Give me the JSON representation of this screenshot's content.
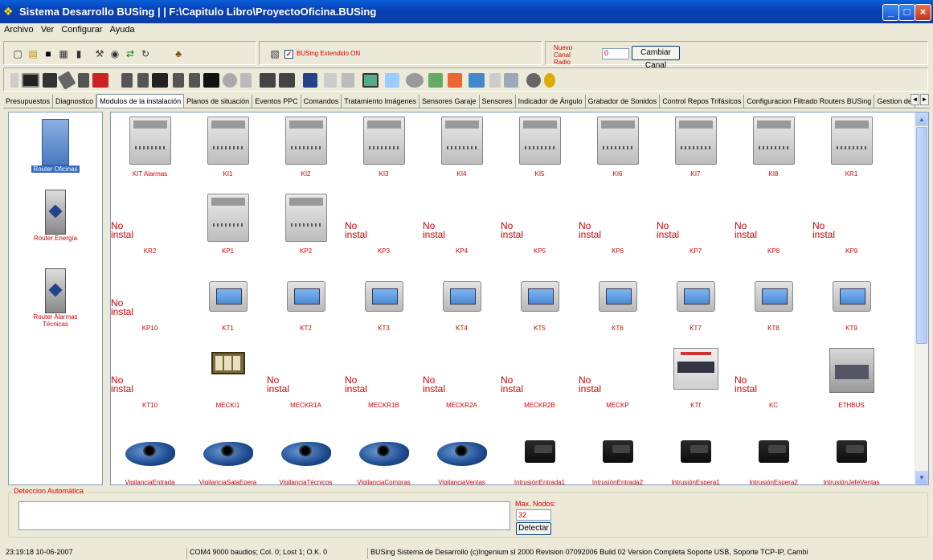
{
  "window": {
    "title": "Sistema Desarrollo BUSing | | F:\\Capitulo Libro\\ProyectoOficina.BUSing",
    "minimize": "_",
    "maximize": "□",
    "close": "×"
  },
  "menu": [
    "Archivo",
    "Ver",
    "Configurar",
    "Ayuda"
  ],
  "toolbar": {
    "extended_label": "BUSing Extendido ON",
    "extended_checked": "✓",
    "nuevo_canal_label": "Nuevo Canal Radio",
    "canal_value": "0",
    "cambiar_canal": "Cambiar Canal",
    "icons": [
      "new-icon",
      "open-icon",
      "save-icon",
      "edit-icon",
      "delete-icon",
      "tools-icon",
      "eye-icon",
      "transfer-icon",
      "refresh-icon",
      "network-icon",
      "scan-icon"
    ]
  },
  "device_toolbar_icons": [
    "module-icon",
    "panel-icon",
    "sensor-icon",
    "pen-icon",
    "din-icon",
    "red-device-icon",
    "din-icon",
    "din-icon",
    "keypad-icon",
    "din-icon",
    "din-icon",
    "black-module-icon",
    "speaker-icon",
    "meter-icon",
    "din-icon",
    "din-icon",
    "screen-icon",
    "switch-icon",
    "box-icon",
    "monitor-icon",
    "tag-icon",
    "camera-icon",
    "window-icon",
    "plant-icon",
    "strip-icon",
    "pipe-icon",
    "sprinkler-icon",
    "gear-icon",
    "key-icon"
  ],
  "tabs": [
    "Presupuestos",
    "Diagnostico",
    "Modulos de la instalación",
    "Planos de situación",
    "Eventos PPC",
    "Comandos",
    "Tratamiento Imágenes",
    "Sensores Garaje",
    "Sensores",
    "Indicador de Ángulo",
    "Grabador de Sonidos",
    "Control Repos Trifásicos",
    "Configuracion Filtrado Routers BUSing",
    "Gestion de"
  ],
  "active_tab": "Modulos de la instalación",
  "tab_scroll_left": "◄",
  "tab_scroll_right": "►",
  "routers": [
    {
      "label": "Router Oficinas",
      "selected": true
    },
    {
      "label": "Router Energía",
      "selected": false
    },
    {
      "label": "Router Alarmas Técnicas",
      "selected": false
    }
  ],
  "no_instalado": "No instal",
  "modules": [
    [
      {
        "label": "KIT Alarmas",
        "type": "din",
        "installed": true
      },
      {
        "label": "KI1",
        "type": "din",
        "installed": true
      },
      {
        "label": "KI2",
        "type": "din",
        "installed": true
      },
      {
        "label": "KI3",
        "type": "din",
        "installed": true
      },
      {
        "label": "KI4",
        "type": "din",
        "installed": true
      },
      {
        "label": "KI5",
        "type": "din",
        "installed": true
      },
      {
        "label": "KI6",
        "type": "din",
        "installed": true
      },
      {
        "label": "KI7",
        "type": "din",
        "installed": true
      },
      {
        "label": "KI8",
        "type": "din",
        "installed": true
      },
      {
        "label": "KR1",
        "type": "din",
        "installed": true
      }
    ],
    [
      {
        "label": "KR2",
        "type": "din",
        "installed": false
      },
      {
        "label": "KP1",
        "type": "din",
        "installed": true
      },
      {
        "label": "KP2",
        "type": "din",
        "installed": true
      },
      {
        "label": "KP3",
        "type": "din",
        "installed": false
      },
      {
        "label": "KP4",
        "type": "din",
        "installed": false
      },
      {
        "label": "KP5",
        "type": "din",
        "installed": false
      },
      {
        "label": "KP6",
        "type": "din",
        "installed": false
      },
      {
        "label": "KP7",
        "type": "din",
        "installed": false
      },
      {
        "label": "KP8",
        "type": "din",
        "installed": false
      },
      {
        "label": "KP9",
        "type": "din",
        "installed": false
      }
    ],
    [
      {
        "label": "KP10",
        "type": "panel",
        "installed": false
      },
      {
        "label": "KT1",
        "type": "panel",
        "installed": true
      },
      {
        "label": "KT2",
        "type": "panel",
        "installed": true
      },
      {
        "label": "KT3",
        "type": "panel",
        "installed": true
      },
      {
        "label": "KT4",
        "type": "panel",
        "installed": true
      },
      {
        "label": "KT5",
        "type": "panel",
        "installed": true
      },
      {
        "label": "KT6",
        "type": "panel",
        "installed": true
      },
      {
        "label": "KT7",
        "type": "panel",
        "installed": true
      },
      {
        "label": "KT8",
        "type": "panel",
        "installed": true
      },
      {
        "label": "KT9",
        "type": "panel",
        "installed": true
      }
    ],
    [
      {
        "label": "KT10",
        "type": "panel",
        "installed": false
      },
      {
        "label": "MECKI1",
        "type": "meck",
        "installed": true
      },
      {
        "label": "MECKR1A",
        "type": "meck",
        "installed": false
      },
      {
        "label": "MECKR1B",
        "type": "meck",
        "installed": false
      },
      {
        "label": "MECKR2A",
        "type": "meck",
        "installed": false
      },
      {
        "label": "MECKR2B",
        "type": "meck",
        "installed": false
      },
      {
        "label": "MECKP",
        "type": "meck",
        "installed": false
      },
      {
        "label": "KTf",
        "type": "ktf",
        "installed": true
      },
      {
        "label": "KC",
        "type": "ktf",
        "installed": false
      },
      {
        "label": "ETHBUS",
        "type": "eth",
        "installed": true
      }
    ],
    [
      {
        "label": "VigilanciaEntrada",
        "type": "cam",
        "installed": true
      },
      {
        "label": "VigilanciaSalaEpera",
        "type": "cam",
        "installed": true
      },
      {
        "label": "VigilanciaTécnicos",
        "type": "cam",
        "installed": true
      },
      {
        "label": "VigilanciaCompras",
        "type": "cam",
        "installed": true
      },
      {
        "label": "VigilanciaVentas",
        "type": "cam",
        "installed": true
      },
      {
        "label": "IntrusiónEntrada1",
        "type": "pir",
        "installed": true
      },
      {
        "label": "IntrusiónEntrada2",
        "type": "pir",
        "installed": true
      },
      {
        "label": "IntrusiónEspera1",
        "type": "pir",
        "installed": true
      },
      {
        "label": "IntrusiónEspera2",
        "type": "pir",
        "installed": true
      },
      {
        "label": "IntrusiónJefeVentas",
        "type": "pir",
        "installed": true
      }
    ]
  ],
  "deteccion": {
    "legend": "Deteccion Automática",
    "max_nodos_label": "Max. Nodos:",
    "max_nodos_value": "32",
    "detectar": "Detectar"
  },
  "status": {
    "datetime": "23:19:18   10-06-2007",
    "port": "COM4 9000 baudios; Col. 0; Lost 1; O.K. 0",
    "info": "BUSing Sistema de Desarrollo (c)Ingenium sl 2000 Revision 07092006 Build 02 Version Completa Soporte USB, Soporte TCP-IP, Cambi"
  },
  "colors": {
    "accent": "#d40000",
    "titlebar": "#0a5fd8",
    "selection": "#316ac5"
  }
}
